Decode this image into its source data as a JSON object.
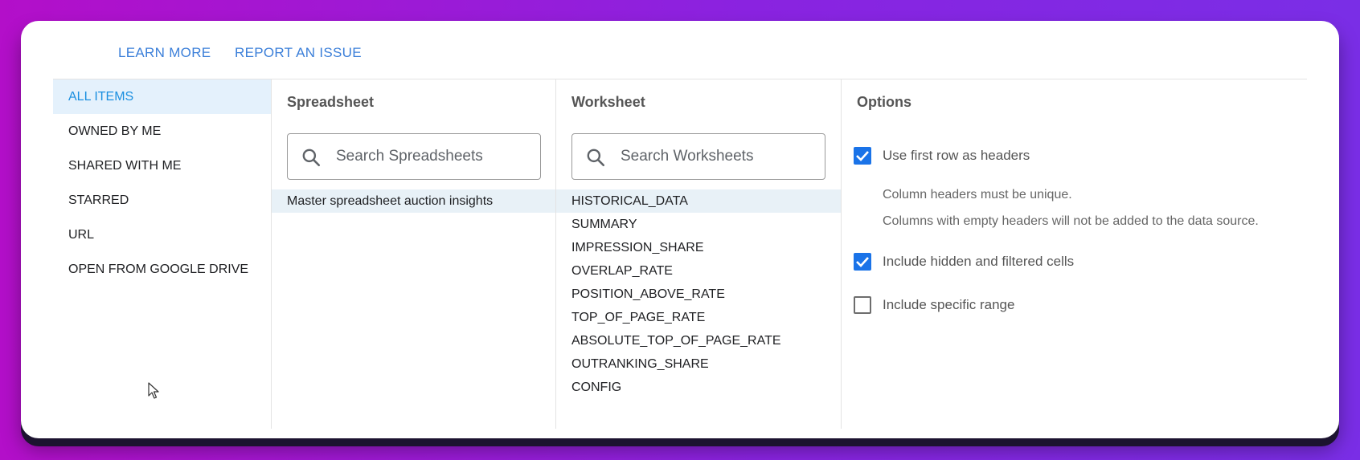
{
  "top_links": {
    "learn_more": "LEARN MORE",
    "report_issue": "REPORT AN ISSUE"
  },
  "sources": {
    "items": [
      {
        "label": "ALL ITEMS",
        "active": true
      },
      {
        "label": "OWNED BY ME",
        "active": false
      },
      {
        "label": "SHARED WITH ME",
        "active": false
      },
      {
        "label": "STARRED",
        "active": false
      },
      {
        "label": "URL",
        "active": false
      },
      {
        "label": "OPEN FROM GOOGLE DRIVE",
        "active": false
      }
    ]
  },
  "spreadsheet": {
    "title": "Spreadsheet",
    "search_placeholder": "Search Spreadsheets",
    "items": [
      "Master spreadsheet auction insights"
    ]
  },
  "worksheet": {
    "title": "Worksheet",
    "search_placeholder": "Search Worksheets",
    "items": [
      "HISTORICAL_DATA",
      "SUMMARY",
      "IMPRESSION_SHARE",
      "OVERLAP_RATE",
      "POSITION_ABOVE_RATE",
      "TOP_OF_PAGE_RATE",
      "ABSOLUTE_TOP_OF_PAGE_RATE",
      "OUTRANKING_SHARE",
      "CONFIG"
    ]
  },
  "options": {
    "title": "Options",
    "first_row_headers": {
      "label": "Use first row as headers",
      "checked": true
    },
    "note_unique": "Column headers must be unique.",
    "note_empty": "Columns with empty headers will not be added to the data source.",
    "include_hidden": {
      "label": "Include hidden and filtered cells",
      "checked": true
    },
    "include_range": {
      "label": "Include specific range",
      "checked": false
    }
  },
  "colors": {
    "accent": "#1a73e8",
    "link": "#3b7fd9",
    "active_bg": "#e4f1fc"
  }
}
